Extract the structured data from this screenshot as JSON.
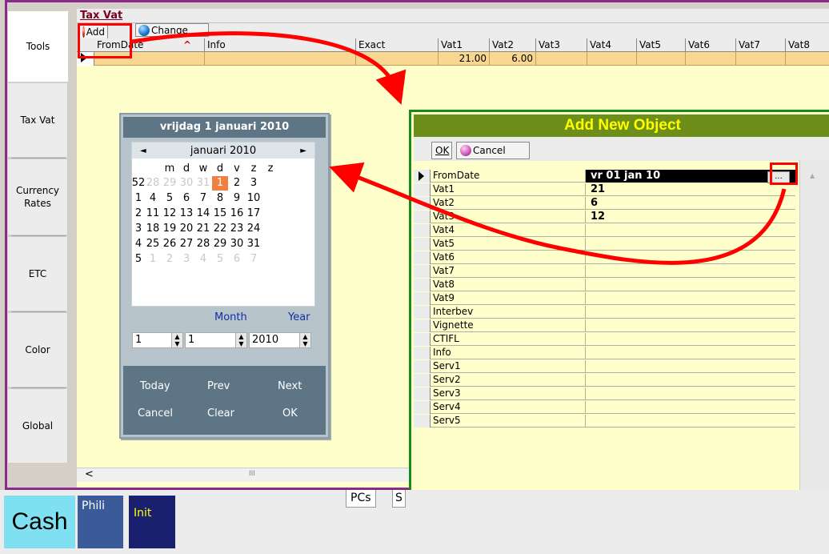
{
  "left_tabs": [
    "Tools",
    "Tax Vat",
    "Currency Rates",
    "ETC",
    "Color",
    "Global"
  ],
  "panel_title": "Tax Vat",
  "toolbar": {
    "add": "Add",
    "change": "Change"
  },
  "grid": {
    "columns": [
      "FromDate",
      "Info",
      "Exact",
      "Vat1",
      "Vat2",
      "Vat3",
      "Vat4",
      "Vat5",
      "Vat6",
      "Vat7",
      "Vat8"
    ],
    "row": {
      "vat1": "21.00",
      "vat2": "6.00"
    }
  },
  "calendar": {
    "header": "vrijdag 1 januari 2010",
    "month_label": "januari 2010",
    "prev_arrow": "◄",
    "next_arrow": "►",
    "weekdays": [
      "m",
      "d",
      "w",
      "d",
      "v",
      "z",
      "z"
    ],
    "weeks": [
      {
        "wk": "52",
        "days": [
          "28",
          "29",
          "30",
          "31",
          "1",
          "2",
          "3"
        ],
        "dim": [
          true,
          true,
          true,
          true,
          false,
          false,
          false
        ],
        "selected": 4
      },
      {
        "wk": "1",
        "days": [
          "4",
          "5",
          "6",
          "7",
          "8",
          "9",
          "10"
        ],
        "dim": [
          false,
          false,
          false,
          false,
          false,
          false,
          false
        ],
        "selected": -1
      },
      {
        "wk": "2",
        "days": [
          "11",
          "12",
          "13",
          "14",
          "15",
          "16",
          "17"
        ],
        "dim": [
          false,
          false,
          false,
          false,
          false,
          false,
          false
        ],
        "selected": -1
      },
      {
        "wk": "3",
        "days": [
          "18",
          "19",
          "20",
          "21",
          "22",
          "23",
          "24"
        ],
        "dim": [
          false,
          false,
          false,
          false,
          false,
          false,
          false
        ],
        "selected": -1
      },
      {
        "wk": "4",
        "days": [
          "25",
          "26",
          "27",
          "28",
          "29",
          "30",
          "31"
        ],
        "dim": [
          false,
          false,
          false,
          false,
          false,
          false,
          false
        ],
        "selected": -1
      },
      {
        "wk": "5",
        "days": [
          "1",
          "2",
          "3",
          "4",
          "5",
          "6",
          "7"
        ],
        "dim": [
          true,
          true,
          true,
          true,
          true,
          true,
          true
        ],
        "selected": -1
      }
    ],
    "month_caption": "Month",
    "year_caption": "Year",
    "day_value": "1",
    "month_value": "1",
    "year_value": "2010",
    "buttons": {
      "today": "Today",
      "prev": "Prev",
      "next": "Next",
      "cancel": "Cancel",
      "clear": "Clear",
      "ok": "OK"
    }
  },
  "add_object": {
    "title": "Add New Object",
    "ok": "OK",
    "cancel": "Cancel",
    "ellipsis": "...",
    "fields": [
      {
        "name": "FromDate",
        "value": "vr 01 jan 10"
      },
      {
        "name": "Vat1",
        "value": "21"
      },
      {
        "name": "Vat2",
        "value": "6"
      },
      {
        "name": "Vat3",
        "value": "12"
      },
      {
        "name": "Vat4",
        "value": ""
      },
      {
        "name": "Vat5",
        "value": ""
      },
      {
        "name": "Vat6",
        "value": ""
      },
      {
        "name": "Vat7",
        "value": ""
      },
      {
        "name": "Vat8",
        "value": ""
      },
      {
        "name": "Vat9",
        "value": ""
      },
      {
        "name": "Interbev",
        "value": ""
      },
      {
        "name": "Vignette",
        "value": ""
      },
      {
        "name": "CTIFL",
        "value": ""
      },
      {
        "name": "Info",
        "value": ""
      },
      {
        "name": "Serv1",
        "value": ""
      },
      {
        "name": "Serv2",
        "value": ""
      },
      {
        "name": "Serv3",
        "value": ""
      },
      {
        "name": "Serv4",
        "value": ""
      },
      {
        "name": "Serv5",
        "value": ""
      }
    ]
  },
  "bottom": {
    "cash": "Cash",
    "phili": "Phili",
    "init": "Init",
    "pcs": "PCs",
    "s": "S"
  },
  "hscroll_thumb": "III",
  "colors": {
    "annotation": "#ff0000",
    "window_border": "#8a2a8a",
    "dialog_border": "#1a8a1a",
    "dialog_title": "#6e8e1a",
    "calendar_header": "#5d7584",
    "grid_row": "#f8d890",
    "panel_bg": "#ffffcc"
  }
}
